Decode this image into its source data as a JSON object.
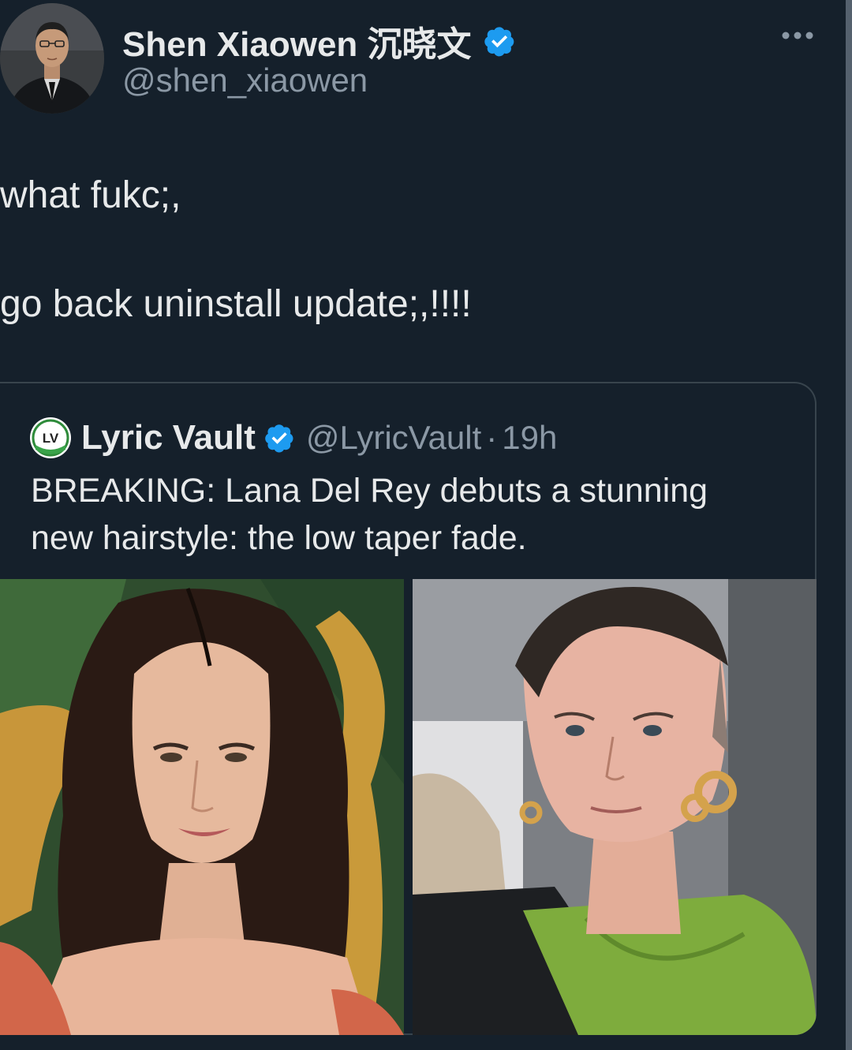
{
  "author": {
    "display_name": "Shen Xiaowen 沉晓文",
    "handle": "@shen_xiaowen",
    "verified": true,
    "avatar": "profile-photo"
  },
  "tweet": {
    "lines": [
      "what fukc;,",
      "go back uninstall update;,!!!!"
    ]
  },
  "quoted": {
    "logo_text": "LV",
    "name": "Lyric Vault",
    "verified": true,
    "handle": "@LyricVault",
    "separator": "·",
    "time": "19h",
    "text_lines": [
      "BREAKING: Lana Del Rey debuts a stunning",
      "new hairstyle: the low taper fade."
    ],
    "images": [
      "portrait-long-hair",
      "portrait-short-hair"
    ]
  },
  "icons": {
    "verified": "verified-badge-icon",
    "more": "more-options-icon"
  },
  "colors": {
    "background": "#15202b",
    "text": "#e7e9ea",
    "secondary": "#8b98a5",
    "verified": "#1d9bf0",
    "border": "#38444d"
  }
}
